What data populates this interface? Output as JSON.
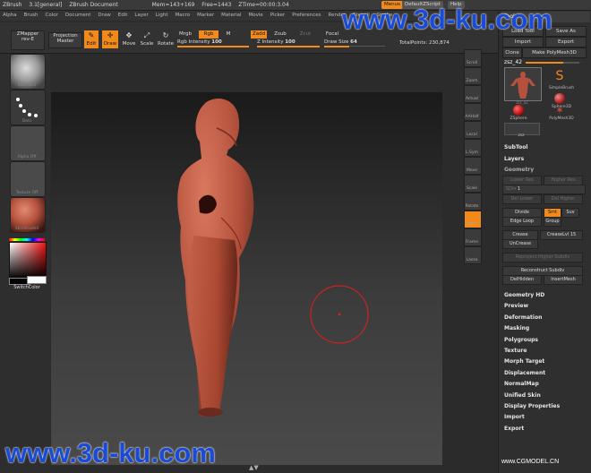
{
  "title_bar": {
    "app": "ZBrush",
    "version": "3.1[general]",
    "doc": "ZBrush Document",
    "mem": "Mem=143+169",
    "free": "Free=1443",
    "ztime": "ZTime=00:00:3.04",
    "menus_btn": "Menus",
    "script_btn": "DefaultZScript",
    "help_btn": "Help"
  },
  "menu_bar": [
    "Alpha",
    "Brush",
    "Color",
    "Document",
    "Draw",
    "Edit",
    "Layer",
    "Light",
    "Macro",
    "Marker",
    "Material",
    "Movie",
    "Picker",
    "Preferences",
    "Render",
    "Stencil",
    "Stroke"
  ],
  "toolbar": {
    "zmapper": "ZMapper",
    "zmapper_sub": "rev-E",
    "projection": "Projection",
    "master": "Master",
    "edit": "Edit",
    "draw": "Draw",
    "move": "Move",
    "scale": "Scale",
    "rotate": "Rotate",
    "mrgb": "Mrgb",
    "rgb": "Rgb",
    "m": "M",
    "zadd": "Zadd",
    "zsub": "Zsub",
    "zcut": "Zcut",
    "focal": "Focal",
    "rgb_intensity": "Rgb Intensity",
    "rgb_intensity_val": "100",
    "z_intensity": "Z Intensity",
    "z_intensity_val": "100",
    "draw_size": "Draw Size",
    "draw_size_val": "64",
    "total_points": "TotalPoints: 230,874"
  },
  "left_panel": {
    "thumbs": [
      "Standard",
      "Dots",
      "Alpha Off",
      "Texture Off",
      "SkinShade4"
    ],
    "switch_color": "SwitchColor"
  },
  "right_strip": [
    "Scroll",
    "Zoom",
    "Actual",
    "AAHalf",
    "Local",
    "L.Sym",
    "Move",
    "Scale",
    "Rotate",
    "Xyz",
    "Frame",
    "Lasso"
  ],
  "tool": {
    "header": "Tool",
    "load": "Load Tool",
    "save": "Save As",
    "import": "Import",
    "export": "Export",
    "clone": "Clone",
    "make": "Make PolyMesh3D",
    "current": "zsz_42",
    "items": [
      {
        "label": "zsz_42",
        "name": "figure"
      },
      {
        "label": "SimpleBrush",
        "name": "simplebrush"
      },
      {
        "label": "Sphere3D",
        "name": "sphere3d"
      },
      {
        "label": "ZSphere",
        "name": "zsphere"
      },
      {
        "label": "PolyMesh3D",
        "name": "polymesh3d"
      },
      {
        "label": "zsz",
        "name": "zsz-small"
      }
    ],
    "subtool": "SubTool",
    "layers": "Layers",
    "geometry": "Geometry",
    "lower_res": "Lower Res",
    "higher_res": "Higher Res",
    "sdiv": "SDiv",
    "sdiv_val": "1",
    "del_lower": "Del Lower",
    "del_higher": "Del Higher",
    "divide": "Divide",
    "smt": "Smt",
    "suv": "Suv",
    "edge_loop": "Edge Loop",
    "group": "Group",
    "crease": "Crease",
    "crease_lvl": "CreaseLvl",
    "crease_lvl_val": "15",
    "uncrease": "UnCrease",
    "reproject": "Reproject Higher Subdiv",
    "reconstruct": "Reconstruct Subdiv",
    "delhidden": "DelHidden",
    "inserthmesh": "InsertMesh",
    "sections": [
      "Geometry HD",
      "Preview",
      "Deformation",
      "Masking",
      "Polygroups",
      "Texture",
      "Morph Target",
      "Displacement",
      "NormalMap",
      "Unified Skin",
      "Display Properties",
      "Import",
      "Export"
    ]
  },
  "watermarks": {
    "top": "www.3d-ku.com",
    "bottom": "www.3d-ku.com",
    "corner": "www.CGMODEL.CN"
  },
  "colors": {
    "accent": "#f08a1c",
    "skin": "#b5523d",
    "watermark": "#1a4bd6"
  }
}
